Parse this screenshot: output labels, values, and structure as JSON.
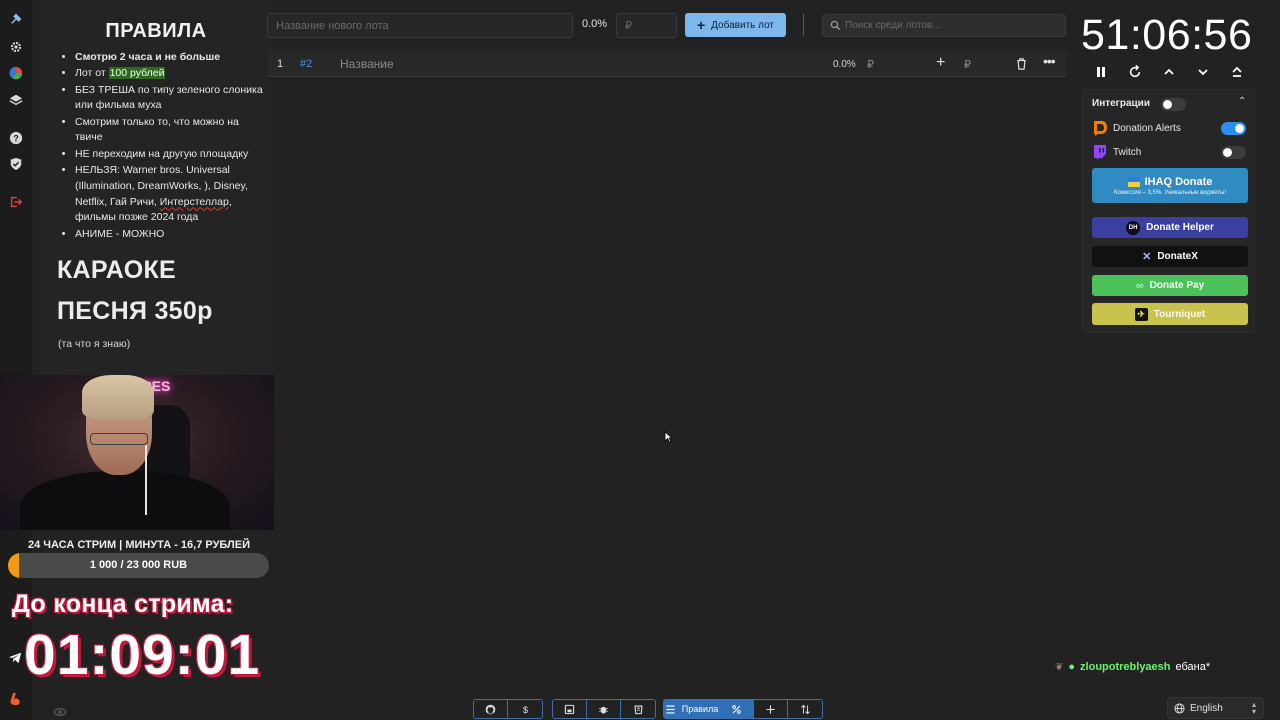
{
  "rules": {
    "title": "ПРАВИЛА",
    "items": {
      "i0": "Смотрю 2 часа и не больше",
      "i1_pre": "Лот от ",
      "i1_hl": "100 рублей",
      "i2": "БЕЗ ТРЕША по типу зеленого слоника или фильма муха",
      "i3": "Смотрим только то, что можно на твиче",
      "i4": "НЕ переходим на другую площадку",
      "i5_pre": "НЕЛЬЗЯ: Warner bros. Universal (Illumination, DreamWorks, ), Disney, Netflix, Гай Ричи, ",
      "i5_sq": "Интерстеллар",
      "i5_post": ", фильмы позже 2024 года",
      "i6": "АНИМЕ - МОЖНО"
    },
    "karaoke_line1": "КАРАОКЕ",
    "karaoke_line2": "ПЕСНЯ 350р",
    "note": "(та что я знаю)"
  },
  "webcam": {
    "neon_sign": "SCOPES"
  },
  "goal": {
    "title": "24 ЧАСА СТРИМ | МИНУТА - 16,7 РУБЛЕЙ",
    "text": "1 000 / 23 000 RUB",
    "current": 1000,
    "target": 23000,
    "fill_color": "#f39c12"
  },
  "stream_end": {
    "label": "До конца стрима:",
    "timer": "01:09:01"
  },
  "lot_form": {
    "name_placeholder": "Название нового лота",
    "percent": "0.0%",
    "amount_placeholder": "₽",
    "add_button": "Добавить лот",
    "search_placeholder": "Поиск среди лотов..."
  },
  "lot": {
    "index": "1",
    "id": "#2",
    "title": "Название",
    "percent": "0.0%",
    "currency": "₽",
    "currency2": "₽"
  },
  "timer": {
    "value": "51:06:56"
  },
  "integrations": {
    "title": "Интеграции",
    "enabled": false,
    "services": [
      {
        "label": "Donation Alerts",
        "enabled": true,
        "icon": "donationalerts-icon"
      },
      {
        "label": "Twitch",
        "enabled": false,
        "icon": "twitch-icon"
      }
    ],
    "ihaq": {
      "label": "IHAQ Donate",
      "sub": "Комиссия – 3,5%. Уникальные виджеты!"
    },
    "buttons": {
      "donate_helper": "Donate Helper",
      "donate_helper_logo": "DH",
      "donatex": "DonateX",
      "donate_pay": "Donate Pay",
      "tourniquet": "Tourniquet"
    },
    "colors": {
      "ihaq": "#2f8bc2",
      "donate_helper": "#3a3fa0",
      "donatex": "#111111",
      "donate_pay": "#4cc15a",
      "tourniquet": "#c8c24e",
      "accent": "#7cb7ee"
    }
  },
  "chat": {
    "user": "zloupotreblyaesh",
    "message": "ебана*"
  },
  "language": {
    "selected": "English"
  },
  "toolbar": {
    "rules_label": "Правила"
  }
}
